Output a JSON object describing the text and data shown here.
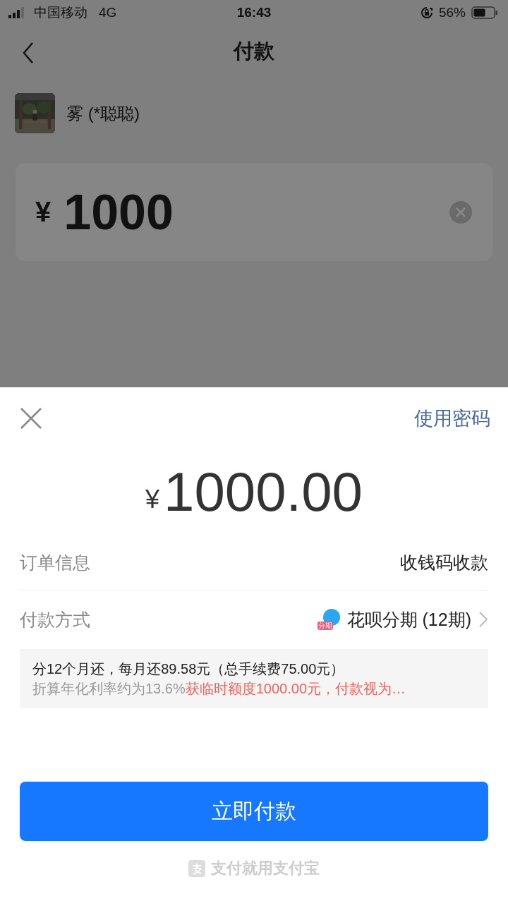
{
  "status_bar": {
    "carrier": "中国移动",
    "network": "4G",
    "time": "16:43",
    "battery": "56%"
  },
  "nav": {
    "title": "付款"
  },
  "payee": {
    "name": "雾 (*聪聪)"
  },
  "amount_field": {
    "currency": "¥",
    "value": "1000"
  },
  "sheet": {
    "use_password": "使用密码",
    "currency": "¥",
    "amount": "1000.00",
    "rows": [
      {
        "label": "订单信息",
        "value": "收钱码收款",
        "kind": "plain"
      },
      {
        "label": "付款方式",
        "value": "花呗分期 (12期)",
        "kind": "method",
        "icon_text": "分期"
      }
    ],
    "plan_line": "分12个月还，每月还89.58元（总手续费75.00元）",
    "rate": "折算年化利率约为13.6%",
    "promo": "获临时额度1000.00元，付款视为…",
    "button": "立即付款",
    "footer": "支付就用支付宝"
  }
}
